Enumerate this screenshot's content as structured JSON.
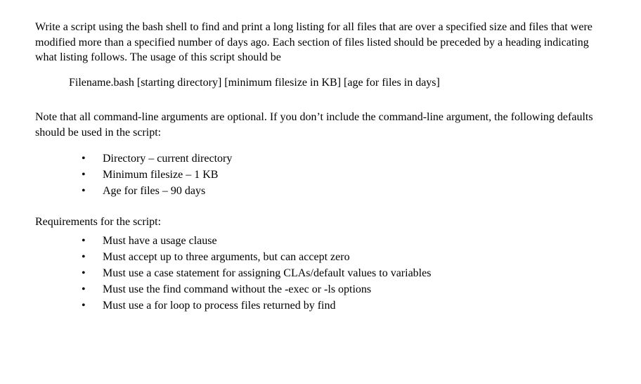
{
  "intro_paragraph": "Write a script using the bash shell to find and print a long listing for all files that are over a specified size and files that were modified more than a specified number of days ago. Each section of files listed should be preceded by a heading indicating what listing follows. The usage of this script should be",
  "usage_line": "Filename.bash   [starting directory]  [minimum filesize in KB]  [age for files in days]",
  "note_paragraph": "Note that all command-line arguments are optional. If you don’t include the command-line argument, the following defaults should be used in the script:",
  "defaults": [
    "Directory – current directory",
    "Minimum filesize – 1 KB",
    "Age for files – 90 days"
  ],
  "requirements_heading": "Requirements for the script:",
  "requirements": [
    "Must have a usage clause",
    "Must accept up to three arguments, but can accept zero",
    "Must use a case statement for assigning CLAs/default values to variables",
    "Must use the find command without the -exec or -ls options",
    "Must use a for loop to process files returned by find"
  ]
}
